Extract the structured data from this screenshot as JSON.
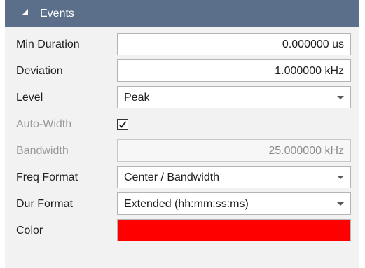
{
  "panel": {
    "title": "Events",
    "expanded": true,
    "collapse_icon": "triangle-expanded-icon"
  },
  "fields": {
    "min_duration": {
      "label": "Min Duration",
      "value": "0.000000 us"
    },
    "deviation": {
      "label": "Deviation",
      "value": "1.000000 kHz"
    },
    "level": {
      "label": "Level",
      "value": "Peak"
    },
    "auto_width": {
      "label": "Auto-Width",
      "checked": true,
      "disabled": true
    },
    "bandwidth": {
      "label": "Bandwidth",
      "value": "25.000000 kHz",
      "disabled": true
    },
    "freq_format": {
      "label": "Freq Format",
      "value": "Center / Bandwidth"
    },
    "dur_format": {
      "label": "Dur Format",
      "value": "Extended (hh:mm:ss:ms)"
    },
    "color": {
      "label": "Color",
      "value": "#ff0000"
    }
  },
  "colors": {
    "header_bg": "#5b6f8a",
    "panel_bg": "#f2f2f2",
    "disabled_text": "#9a9a9a"
  }
}
